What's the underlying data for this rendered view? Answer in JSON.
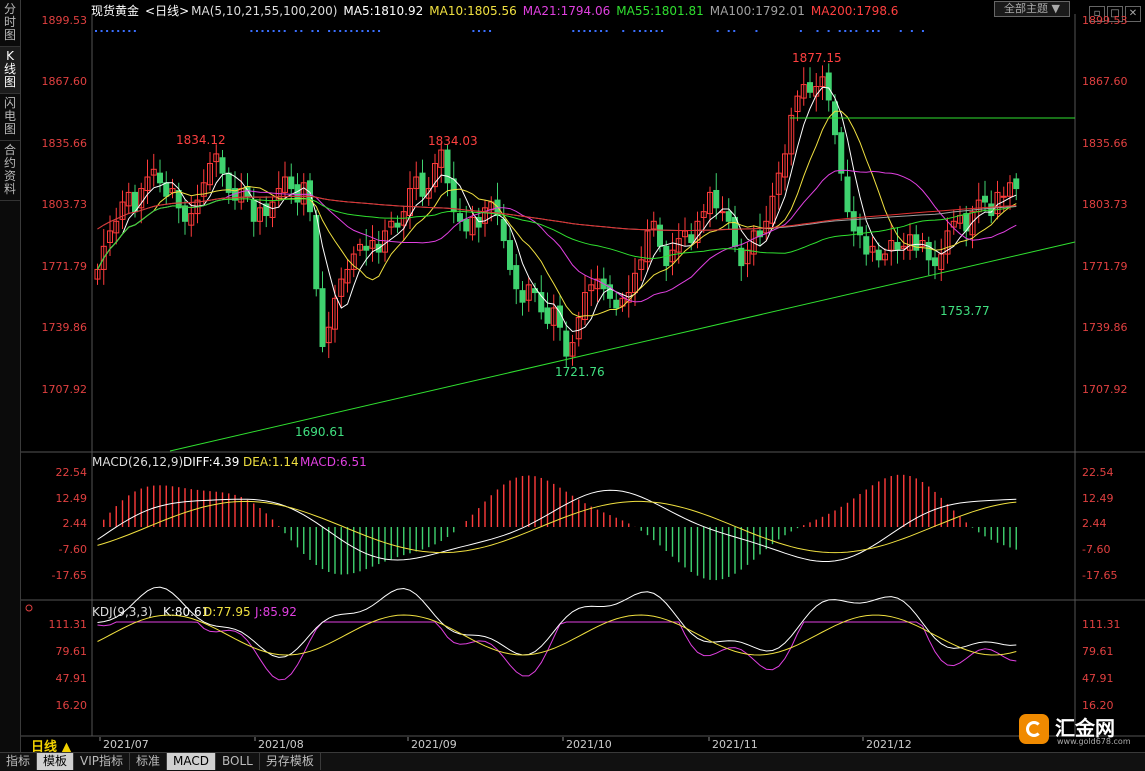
{
  "sidebar": {
    "tabs": [
      {
        "label": "分时图",
        "active": false
      },
      {
        "label": "K线图",
        "active": true
      },
      {
        "label": "闪电图",
        "active": false
      },
      {
        "label": "合约资料",
        "active": false
      }
    ]
  },
  "header": {
    "instrument": "现货黄金",
    "period": "<日线>",
    "ma_params": "MA(5,10,21,55,100,200)",
    "ma5": "MA5:1810.92",
    "ma10": "MA10:1805.56",
    "ma21": "MA21:1794.06",
    "ma55": "MA55:1801.81",
    "ma100": "MA100:1792.01",
    "ma200": "MA200:1798.6",
    "theme_button": "全部主题",
    "theme_arrow": "▼"
  },
  "colors": {
    "up": "#ff3b3b",
    "down": "#3fd26f",
    "ma5": "#ffffff",
    "ma10": "#f0e040",
    "ma21": "#e040e0",
    "ma55": "#30e030",
    "ma100": "#a0a0a0",
    "ma200": "#e03030",
    "trend": "#30e030",
    "axis_price": "#e04040"
  },
  "price_axis": {
    "left": [
      "1899.53",
      "1867.60",
      "1835.66",
      "1803.73",
      "1771.79",
      "1739.86",
      "1707.92"
    ],
    "right": [
      "1899.53",
      "1867.60",
      "1835.66",
      "1803.73",
      "1771.79",
      "1739.86",
      "1707.92"
    ]
  },
  "annotations": {
    "high_aug": "1834.12",
    "high_sep": "1834.03",
    "high_nov": "1877.15",
    "low_aug": "1690.61",
    "low_sep": "1721.76",
    "low_dec": "1753.77"
  },
  "macd": {
    "title": "MACD(26,12,9)",
    "diff": "DIFF:4.39",
    "dea": "DEA:1.14",
    "macd": "MACD:6.51",
    "axis": [
      "22.54",
      "12.49",
      "2.44",
      "-7.60",
      "-17.65"
    ]
  },
  "kdj": {
    "title": "KDJ(9,3,3)",
    "k": "K:80.61",
    "d": "D:77.95",
    "j": "J:85.92",
    "axis": [
      "111.31",
      "79.61",
      "47.91",
      "16.20"
    ]
  },
  "x_axis": [
    "2021/07",
    "2021/08",
    "2021/09",
    "2021/10",
    "2021/11",
    "2021/12"
  ],
  "period_label": "日线 ▲",
  "bottom_tabs": [
    {
      "label": "指标",
      "selected": false
    },
    {
      "label": "模板",
      "selected": true
    },
    {
      "label": "VIP指标",
      "selected": false
    },
    {
      "label": "标准",
      "selected": false
    },
    {
      "label": "MACD",
      "selected": true
    },
    {
      "label": "BOLL",
      "selected": false
    },
    {
      "label": "另存模板",
      "selected": false
    }
  ],
  "logo": {
    "name": "汇金网",
    "url": "www.gold678.com"
  },
  "chart_data": {
    "type": "candlestick",
    "x_labels": [
      "2021/07",
      "2021/08",
      "2021/09",
      "2021/10",
      "2021/11",
      "2021/12"
    ],
    "ylim": [
      1690,
      1900
    ],
    "key_levels": {
      "highs": [
        1834.12,
        1834.03,
        1877.15
      ],
      "lows": [
        1690.61,
        1721.76,
        1753.77
      ]
    },
    "closes": [
      1770,
      1782,
      1790,
      1795,
      1805,
      1810,
      1800,
      1812,
      1818,
      1822,
      1815,
      1808,
      1812,
      1802,
      1795,
      1799,
      1806,
      1815,
      1825,
      1830,
      1820,
      1810,
      1806,
      1812,
      1808,
      1795,
      1802,
      1798,
      1805,
      1812,
      1818,
      1812,
      1805,
      1815,
      1800,
      1760,
      1730,
      1740,
      1755,
      1765,
      1770,
      1778,
      1783,
      1780,
      1785,
      1779,
      1790,
      1795,
      1792,
      1800,
      1812,
      1818,
      1808,
      1812,
      1825,
      1832,
      1815,
      1800,
      1795,
      1790,
      1797,
      1792,
      1802,
      1805,
      1798,
      1785,
      1770,
      1760,
      1753,
      1762,
      1758,
      1748,
      1742,
      1750,
      1740,
      1725,
      1732,
      1745,
      1758,
      1762,
      1765,
      1760,
      1755,
      1750,
      1755,
      1758,
      1768,
      1775,
      1790,
      1795,
      1782,
      1772,
      1780,
      1786,
      1790,
      1784,
      1795,
      1800,
      1810,
      1802,
      1800,
      1795,
      1782,
      1772,
      1780,
      1790,
      1787,
      1795,
      1808,
      1820,
      1830,
      1850,
      1860,
      1866,
      1862,
      1865,
      1870,
      1858,
      1840,
      1820,
      1800,
      1790,
      1788,
      1778,
      1782,
      1775,
      1778,
      1785,
      1780,
      1782,
      1788,
      1780,
      1785,
      1775,
      1772,
      1778,
      1790,
      1795,
      1798,
      1790,
      1800,
      1806,
      1805,
      1798,
      1810,
      1808,
      1815,
      1812
    ]
  }
}
